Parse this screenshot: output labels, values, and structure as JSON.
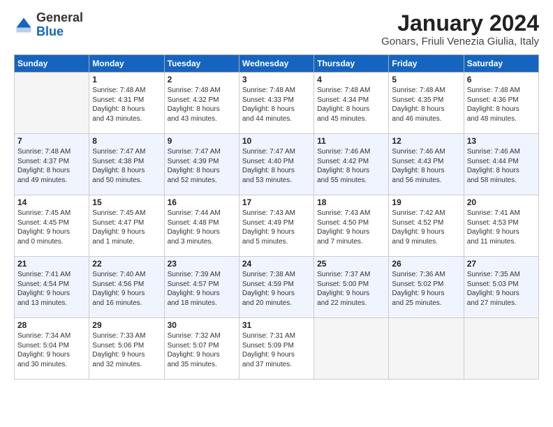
{
  "logo": {
    "general": "General",
    "blue": "Blue"
  },
  "title": "January 2024",
  "subtitle": "Gonars, Friuli Venezia Giulia, Italy",
  "weekdays": [
    "Sunday",
    "Monday",
    "Tuesday",
    "Wednesday",
    "Thursday",
    "Friday",
    "Saturday"
  ],
  "weeks": [
    [
      {
        "day": "",
        "info": ""
      },
      {
        "day": "1",
        "info": "Sunrise: 7:48 AM\nSunset: 4:31 PM\nDaylight: 8 hours\nand 43 minutes."
      },
      {
        "day": "2",
        "info": "Sunrise: 7:48 AM\nSunset: 4:32 PM\nDaylight: 8 hours\nand 43 minutes."
      },
      {
        "day": "3",
        "info": "Sunrise: 7:48 AM\nSunset: 4:33 PM\nDaylight: 8 hours\nand 44 minutes."
      },
      {
        "day": "4",
        "info": "Sunrise: 7:48 AM\nSunset: 4:34 PM\nDaylight: 8 hours\nand 45 minutes."
      },
      {
        "day": "5",
        "info": "Sunrise: 7:48 AM\nSunset: 4:35 PM\nDaylight: 8 hours\nand 46 minutes."
      },
      {
        "day": "6",
        "info": "Sunrise: 7:48 AM\nSunset: 4:36 PM\nDaylight: 8 hours\nand 48 minutes."
      }
    ],
    [
      {
        "day": "7",
        "info": "Sunrise: 7:48 AM\nSunset: 4:37 PM\nDaylight: 8 hours\nand 49 minutes."
      },
      {
        "day": "8",
        "info": "Sunrise: 7:47 AM\nSunset: 4:38 PM\nDaylight: 8 hours\nand 50 minutes."
      },
      {
        "day": "9",
        "info": "Sunrise: 7:47 AM\nSunset: 4:39 PM\nDaylight: 8 hours\nand 52 minutes."
      },
      {
        "day": "10",
        "info": "Sunrise: 7:47 AM\nSunset: 4:40 PM\nDaylight: 8 hours\nand 53 minutes."
      },
      {
        "day": "11",
        "info": "Sunrise: 7:46 AM\nSunset: 4:42 PM\nDaylight: 8 hours\nand 55 minutes."
      },
      {
        "day": "12",
        "info": "Sunrise: 7:46 AM\nSunset: 4:43 PM\nDaylight: 8 hours\nand 56 minutes."
      },
      {
        "day": "13",
        "info": "Sunrise: 7:46 AM\nSunset: 4:44 PM\nDaylight: 8 hours\nand 58 minutes."
      }
    ],
    [
      {
        "day": "14",
        "info": "Sunrise: 7:45 AM\nSunset: 4:45 PM\nDaylight: 9 hours\nand 0 minutes."
      },
      {
        "day": "15",
        "info": "Sunrise: 7:45 AM\nSunset: 4:47 PM\nDaylight: 9 hours\nand 1 minute."
      },
      {
        "day": "16",
        "info": "Sunrise: 7:44 AM\nSunset: 4:48 PM\nDaylight: 9 hours\nand 3 minutes."
      },
      {
        "day": "17",
        "info": "Sunrise: 7:43 AM\nSunset: 4:49 PM\nDaylight: 9 hours\nand 5 minutes."
      },
      {
        "day": "18",
        "info": "Sunrise: 7:43 AM\nSunset: 4:50 PM\nDaylight: 9 hours\nand 7 minutes."
      },
      {
        "day": "19",
        "info": "Sunrise: 7:42 AM\nSunset: 4:52 PM\nDaylight: 9 hours\nand 9 minutes."
      },
      {
        "day": "20",
        "info": "Sunrise: 7:41 AM\nSunset: 4:53 PM\nDaylight: 9 hours\nand 11 minutes."
      }
    ],
    [
      {
        "day": "21",
        "info": "Sunrise: 7:41 AM\nSunset: 4:54 PM\nDaylight: 9 hours\nand 13 minutes."
      },
      {
        "day": "22",
        "info": "Sunrise: 7:40 AM\nSunset: 4:56 PM\nDaylight: 9 hours\nand 16 minutes."
      },
      {
        "day": "23",
        "info": "Sunrise: 7:39 AM\nSunset: 4:57 PM\nDaylight: 9 hours\nand 18 minutes."
      },
      {
        "day": "24",
        "info": "Sunrise: 7:38 AM\nSunset: 4:59 PM\nDaylight: 9 hours\nand 20 minutes."
      },
      {
        "day": "25",
        "info": "Sunrise: 7:37 AM\nSunset: 5:00 PM\nDaylight: 9 hours\nand 22 minutes."
      },
      {
        "day": "26",
        "info": "Sunrise: 7:36 AM\nSunset: 5:02 PM\nDaylight: 9 hours\nand 25 minutes."
      },
      {
        "day": "27",
        "info": "Sunrise: 7:35 AM\nSunset: 5:03 PM\nDaylight: 9 hours\nand 27 minutes."
      }
    ],
    [
      {
        "day": "28",
        "info": "Sunrise: 7:34 AM\nSunset: 5:04 PM\nDaylight: 9 hours\nand 30 minutes."
      },
      {
        "day": "29",
        "info": "Sunrise: 7:33 AM\nSunset: 5:06 PM\nDaylight: 9 hours\nand 32 minutes."
      },
      {
        "day": "30",
        "info": "Sunrise: 7:32 AM\nSunset: 5:07 PM\nDaylight: 9 hours\nand 35 minutes."
      },
      {
        "day": "31",
        "info": "Sunrise: 7:31 AM\nSunset: 5:09 PM\nDaylight: 9 hours\nand 37 minutes."
      },
      {
        "day": "",
        "info": ""
      },
      {
        "day": "",
        "info": ""
      },
      {
        "day": "",
        "info": ""
      }
    ]
  ]
}
